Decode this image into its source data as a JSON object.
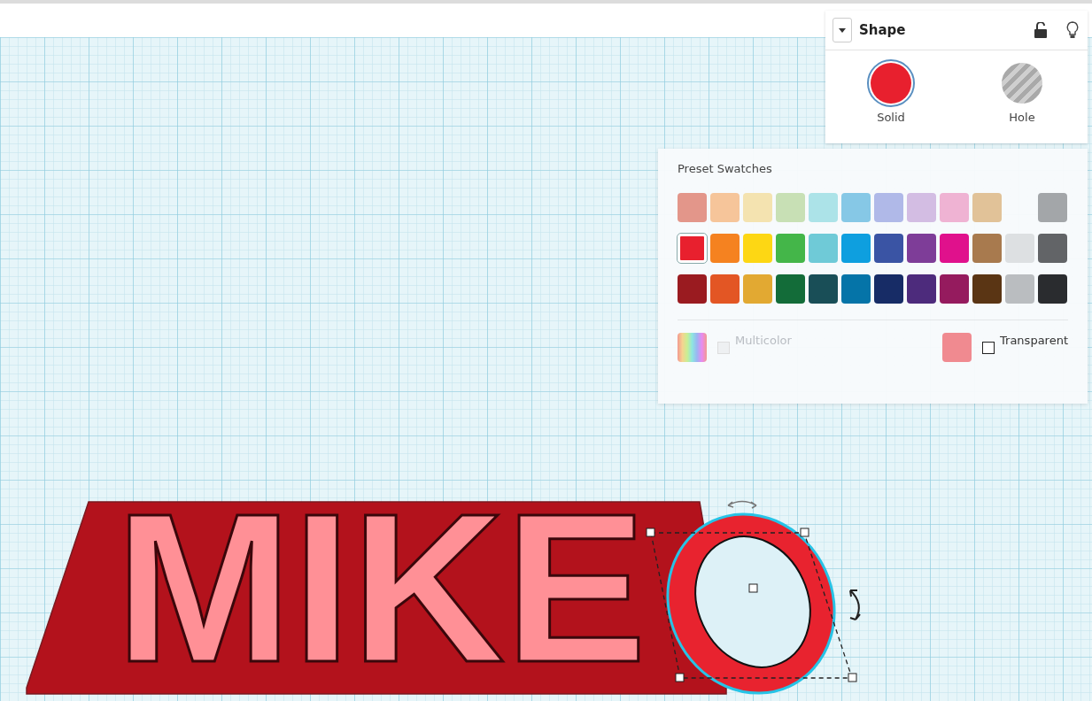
{
  "shape_panel": {
    "title": "Shape",
    "modes": [
      {
        "label": "Solid",
        "kind": "solid",
        "selected": true
      },
      {
        "label": "Hole",
        "kind": "hole",
        "selected": false
      }
    ]
  },
  "color_popup": {
    "title": "Preset Swatches",
    "rows": [
      [
        {
          "kind": "swatch",
          "color": "#e3968a",
          "selected": false
        },
        {
          "kind": "swatch",
          "color": "#f6c59a",
          "selected": false
        },
        {
          "kind": "swatch",
          "color": "#f4e3b0",
          "selected": false
        },
        {
          "kind": "swatch",
          "color": "#c8e0b5",
          "selected": false
        },
        {
          "kind": "swatch",
          "color": "#ace3e8",
          "selected": false
        },
        {
          "kind": "swatch",
          "color": "#86c8e6",
          "selected": false
        },
        {
          "kind": "swatch",
          "color": "#b0b9e8",
          "selected": false
        },
        {
          "kind": "swatch",
          "color": "#d3bde3",
          "selected": false
        },
        {
          "kind": "swatch",
          "color": "#efb3d3",
          "selected": false
        },
        {
          "kind": "swatch",
          "color": "#e1c298",
          "selected": false
        },
        {
          "kind": "empty"
        },
        {
          "kind": "swatch",
          "color": "#a3a6a9",
          "selected": false
        }
      ],
      [
        {
          "kind": "swatch",
          "color": "#e8202e",
          "selected": true
        },
        {
          "kind": "swatch",
          "color": "#f58220",
          "selected": false
        },
        {
          "kind": "swatch",
          "color": "#fdd714",
          "selected": false
        },
        {
          "kind": "swatch",
          "color": "#44b649",
          "selected": false
        },
        {
          "kind": "swatch",
          "color": "#6fcad7",
          "selected": false
        },
        {
          "kind": "swatch",
          "color": "#0e9fdf",
          "selected": false
        },
        {
          "kind": "swatch",
          "color": "#3a54a4",
          "selected": false
        },
        {
          "kind": "swatch",
          "color": "#7e3d98",
          "selected": false
        },
        {
          "kind": "swatch",
          "color": "#e0118c",
          "selected": false
        },
        {
          "kind": "swatch",
          "color": "#a87a4e",
          "selected": false
        },
        {
          "kind": "swatch",
          "color": "#dde0e2",
          "selected": false
        },
        {
          "kind": "swatch",
          "color": "#626467",
          "selected": false
        }
      ],
      [
        {
          "kind": "swatch",
          "color": "#9a1b20",
          "selected": false
        },
        {
          "kind": "swatch",
          "color": "#e35624",
          "selected": false
        },
        {
          "kind": "swatch",
          "color": "#e2a932",
          "selected": false
        },
        {
          "kind": "swatch",
          "color": "#136c39",
          "selected": false
        },
        {
          "kind": "swatch",
          "color": "#194e57",
          "selected": false
        },
        {
          "kind": "swatch",
          "color": "#0574a8",
          "selected": false
        },
        {
          "kind": "swatch",
          "color": "#172c66",
          "selected": false
        },
        {
          "kind": "swatch",
          "color": "#4d2b7c",
          "selected": false
        },
        {
          "kind": "swatch",
          "color": "#951b5e",
          "selected": false
        },
        {
          "kind": "swatch",
          "color": "#5a3514",
          "selected": false
        },
        {
          "kind": "swatch",
          "color": "#babdc0",
          "selected": false
        },
        {
          "kind": "swatch",
          "color": "#2a2c2f",
          "selected": false
        }
      ]
    ],
    "multicolor": {
      "label": "Multicolor",
      "checked": false,
      "disabled": true
    },
    "custom_color": {
      "color": "#f08a90"
    },
    "transparent": {
      "label": "Transparent",
      "checked": false
    }
  },
  "model": {
    "text": "MIKE"
  }
}
